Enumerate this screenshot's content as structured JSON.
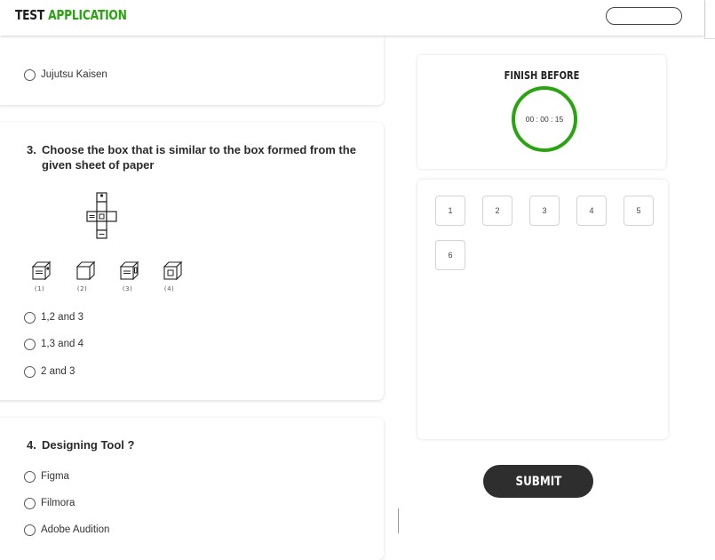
{
  "header": {
    "brand_part1": "TEST",
    "brand_part2": "APPLICATION"
  },
  "question2": {
    "visible_option": "Jujutsu Kaisen"
  },
  "question3": {
    "number": "3.",
    "text": "Choose the box that is similar to the box formed from the given sheet of paper",
    "figure_captions": [
      "(1)",
      "(2)",
      "(3)",
      "(4)"
    ],
    "options": [
      "1,2 and 3",
      "1,3 and 4",
      "2 and 3"
    ]
  },
  "question4": {
    "number": "4.",
    "text": "Designing Tool ?",
    "options": [
      "Figma",
      "Filmora",
      "Adobe Audition"
    ]
  },
  "timer": {
    "title": "FINISH BEFORE",
    "value": "00 : 00 : 15"
  },
  "navigator": {
    "buttons": [
      "1",
      "2",
      "3",
      "4",
      "5",
      "6"
    ]
  },
  "submit_label": "SUBMIT",
  "colors": {
    "accent_green": "#2aa511",
    "submit_bg": "#2e2e2e"
  }
}
